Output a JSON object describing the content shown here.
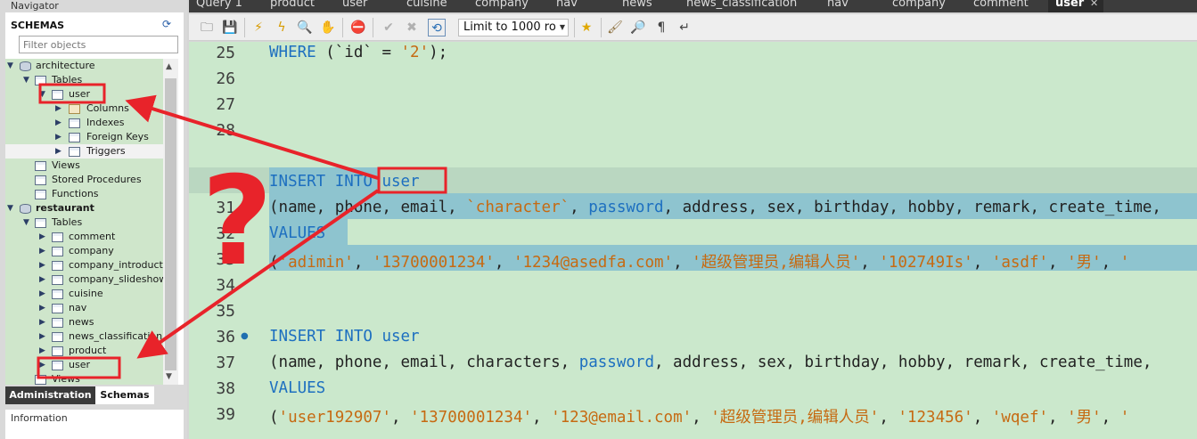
{
  "navigator": {
    "title": "Navigator",
    "schemas_label": "SCHEMAS",
    "filter_placeholder": "Filter objects",
    "tree": {
      "architecture": "architecture",
      "arch_tables": "Tables",
      "arch_user": "user",
      "arch_columns": "Columns",
      "arch_indexes": "Indexes",
      "arch_foreign_keys": "Foreign Keys",
      "arch_triggers": "Triggers",
      "arch_views": "Views",
      "arch_stored_procedures": "Stored Procedures",
      "arch_functions": "Functions",
      "restaurant": "restaurant",
      "rest_tables": "Tables",
      "rest_tables_items": [
        "comment",
        "company",
        "company_introductio",
        "company_slideshow",
        "cuisine",
        "nav",
        "news",
        "news_classification",
        "product",
        "user"
      ],
      "rest_views": "Views"
    },
    "tabs": {
      "administration": "Administration",
      "schemas": "Schemas"
    },
    "information_label": "Information"
  },
  "editor": {
    "tabs": [
      "Query 1",
      "product",
      "user",
      "cuisine",
      "company",
      "nav",
      "news",
      "news_classification",
      "nav",
      "company",
      "comment",
      "user"
    ],
    "active_tab": "user",
    "close_glyph": "✕",
    "limit_select": "Limit to 1000 ro",
    "lines": {
      "n25": "25",
      "n26": "26",
      "n27": "27",
      "n28": "28",
      "n30": "30",
      "n31": "31",
      "n32": "32",
      "n33": "33",
      "n34": "34",
      "n35": "35",
      "n36": "36",
      "n37": "37",
      "n38": "38",
      "n39": "39"
    },
    "code": {
      "l25_kw": "WHERE",
      "l25_rest": " (`id` = ",
      "l25_str": "'2'",
      "l25_end": ");",
      "l30_kw": "INSERT INTO",
      "l30_tbl": " user",
      "l31_a": "(name, phone, email, ",
      "l31_str": "`character`",
      "l31_b": ", ",
      "l31_kw": "password",
      "l31_c": ", address, sex, birthday, hobby, remark, create_time,",
      "l32_kw": "VALUES",
      "l33_a": "(",
      "l33_s1": "'adimin'",
      "l33_s2": "'13700001234'",
      "l33_s3": "'1234@asedfa.com'",
      "l33_s4": "'超级管理员,编辑人员'",
      "l33_s5": "'102749Is'",
      "l33_s6": "'asdf'",
      "l33_s7": "'男'",
      "l33_s8": "'",
      "sep": ", ",
      "l36_kw": "INSERT INTO",
      "l36_tbl": " user",
      "l37_a": "(name, phone, email, characters, ",
      "l37_kw": "password",
      "l37_c": ", address, sex, birthday, hobby, remark, create_time,",
      "l38_kw": "VALUES",
      "l39_a": "(",
      "l39_s1": "'user192907'",
      "l39_s2": "'13700001234'",
      "l39_s3": "'123@email.com'",
      "l39_s4": "'超级管理员,编辑人员'",
      "l39_s5": "'123456'",
      "l39_s6": "'wqef'",
      "l39_s7": "'男'",
      "l39_s8": "'"
    }
  },
  "annotation": {
    "glyph": "?",
    "color": "#e8232a"
  }
}
